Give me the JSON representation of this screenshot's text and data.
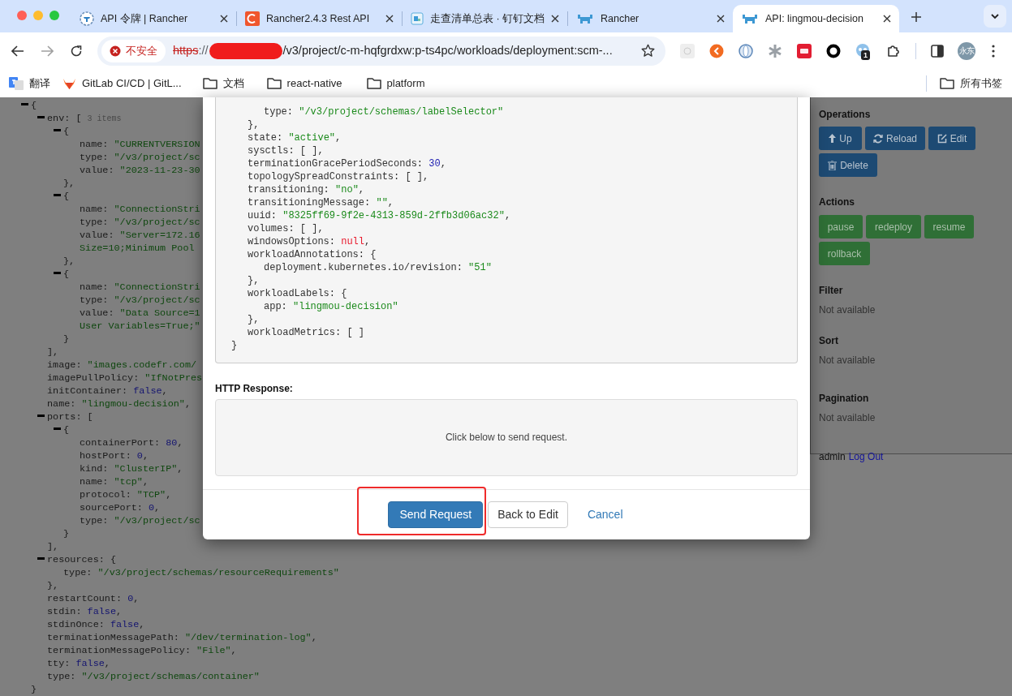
{
  "browser": {
    "tabs": [
      {
        "title": "API 令牌 | Rancher",
        "kind": "round",
        "selected": false
      },
      {
        "title": "Rancher2.4.3 Rest API",
        "kind": "orange",
        "selected": false
      },
      {
        "title": "走查清单总表 · 钉钉文档",
        "kind": "doc",
        "selected": false
      },
      {
        "title": "Rancher",
        "kind": "cattle",
        "selected": false
      },
      {
        "title": "API: lingmou-decision",
        "kind": "cattle",
        "selected": true
      }
    ],
    "security_label": "不安全",
    "url": {
      "scheme": "https",
      "separator": "://",
      "path": "/v3/project/c-m-hqfgrdxw:p-ts4pc/workloads/deployment:scm-..."
    },
    "extension_badge": "1",
    "avatar": "永东",
    "bookmarks": [
      {
        "kind": "translate",
        "label": "翻译"
      },
      {
        "kind": "gitlab",
        "label": "GitLab CI/CD | GitL..."
      },
      {
        "kind": "folder",
        "label": "文档"
      },
      {
        "kind": "folder",
        "label": "react-native"
      },
      {
        "kind": "folder",
        "label": "platform"
      }
    ],
    "all_bookmarks": "所有书签"
  },
  "page_code": {
    "expanded": true,
    "parts": [
      {
        "kind": "p",
        "text": "{"
      }
    ],
    "children": [
      {
        "expanded": true,
        "parts": [
          {
            "kind": "k",
            "text": "env: "
          },
          {
            "kind": "p",
            "text": "[ "
          },
          {
            "kind": "c",
            "text": "3 items"
          }
        ],
        "children": [
          {
            "expanded": true,
            "parts": [
              {
                "kind": "p",
                "text": "{"
              }
            ],
            "children": [
              {
                "parts": [
                  {
                    "kind": "k",
                    "text": "name: "
                  },
                  {
                    "kind": "s",
                    "text": "\"CURRENTVERSION"
                  }
                ]
              },
              {
                "parts": [
                  {
                    "kind": "k",
                    "text": "type: "
                  },
                  {
                    "kind": "s",
                    "text": "\"/v3/project/sc"
                  }
                ]
              },
              {
                "parts": [
                  {
                    "kind": "k",
                    "text": "value: "
                  },
                  {
                    "kind": "s",
                    "text": "\"2023-11-23-30"
                  }
                ]
              }
            ],
            "close": [
              {
                "kind": "p",
                "text": "},"
              }
            ]
          },
          {
            "expanded": true,
            "parts": [
              {
                "kind": "p",
                "text": "{"
              }
            ],
            "children": [
              {
                "parts": [
                  {
                    "kind": "k",
                    "text": "name: "
                  },
                  {
                    "kind": "s",
                    "text": "\"ConnectionStri"
                  }
                ]
              },
              {
                "parts": [
                  {
                    "kind": "k",
                    "text": "type: "
                  },
                  {
                    "kind": "s",
                    "text": "\"/v3/project/sc"
                  }
                ]
              },
              {
                "parts": [
                  {
                    "kind": "k",
                    "text": "value: "
                  },
                  {
                    "kind": "s",
                    "text": "\"Server=172.16"
                  }
                ]
              },
              {
                "parts": [
                  {
                    "kind": "s",
                    "text": "Size=10;Minimum Pool"
                  }
                ]
              }
            ],
            "close": [
              {
                "kind": "p",
                "text": "},"
              }
            ]
          },
          {
            "expanded": true,
            "parts": [
              {
                "kind": "p",
                "text": "{"
              }
            ],
            "children": [
              {
                "parts": [
                  {
                    "kind": "k",
                    "text": "name: "
                  },
                  {
                    "kind": "s",
                    "text": "\"ConnectionStri"
                  }
                ]
              },
              {
                "parts": [
                  {
                    "kind": "k",
                    "text": "type: "
                  },
                  {
                    "kind": "s",
                    "text": "\"/v3/project/sc"
                  }
                ]
              },
              {
                "parts": [
                  {
                    "kind": "k",
                    "text": "value: "
                  },
                  {
                    "kind": "s",
                    "text": "\"Data Source=1"
                  }
                ]
              },
              {
                "parts": [
                  {
                    "kind": "s",
                    "text": "User Variables=True;\""
                  }
                ]
              }
            ],
            "close": [
              {
                "kind": "p",
                "text": "}"
              }
            ]
          }
        ],
        "close": [
          {
            "kind": "p",
            "text": "],"
          }
        ]
      },
      {
        "parts": [
          {
            "kind": "k",
            "text": "image: "
          },
          {
            "kind": "s",
            "text": "\"images.codefr.com/"
          }
        ]
      },
      {
        "parts": [
          {
            "kind": "k",
            "text": "imagePullPolicy: "
          },
          {
            "kind": "s",
            "text": "\"IfNotPres"
          }
        ]
      },
      {
        "parts": [
          {
            "kind": "k",
            "text": "initContainer: "
          },
          {
            "kind": "n",
            "text": "false"
          },
          {
            "kind": "p",
            "text": ","
          }
        ]
      },
      {
        "parts": [
          {
            "kind": "k",
            "text": "name: "
          },
          {
            "kind": "s",
            "text": "\"lingmou-decision\""
          },
          {
            "kind": "p",
            "text": ","
          }
        ]
      },
      {
        "expanded": true,
        "parts": [
          {
            "kind": "k",
            "text": "ports: "
          },
          {
            "kind": "p",
            "text": "["
          }
        ],
        "children": [
          {
            "expanded": true,
            "parts": [
              {
                "kind": "p",
                "text": "{"
              }
            ],
            "children": [
              {
                "parts": [
                  {
                    "kind": "k",
                    "text": "containerPort: "
                  },
                  {
                    "kind": "n",
                    "text": "80"
                  },
                  {
                    "kind": "p",
                    "text": ","
                  }
                ]
              },
              {
                "parts": [
                  {
                    "kind": "k",
                    "text": "hostPort: "
                  },
                  {
                    "kind": "n",
                    "text": "0"
                  },
                  {
                    "kind": "p",
                    "text": ","
                  }
                ]
              },
              {
                "parts": [
                  {
                    "kind": "k",
                    "text": "kind: "
                  },
                  {
                    "kind": "s",
                    "text": "\"ClusterIP\""
                  },
                  {
                    "kind": "p",
                    "text": ","
                  }
                ]
              },
              {
                "parts": [
                  {
                    "kind": "k",
                    "text": "name: "
                  },
                  {
                    "kind": "s",
                    "text": "\"tcp\""
                  },
                  {
                    "kind": "p",
                    "text": ","
                  }
                ]
              },
              {
                "parts": [
                  {
                    "kind": "k",
                    "text": "protocol: "
                  },
                  {
                    "kind": "s",
                    "text": "\"TCP\""
                  },
                  {
                    "kind": "p",
                    "text": ","
                  }
                ]
              },
              {
                "parts": [
                  {
                    "kind": "k",
                    "text": "sourcePort: "
                  },
                  {
                    "kind": "n",
                    "text": "0"
                  },
                  {
                    "kind": "p",
                    "text": ","
                  }
                ]
              },
              {
                "parts": [
                  {
                    "kind": "k",
                    "text": "type: "
                  },
                  {
                    "kind": "s",
                    "text": "\"/v3/project/sc"
                  }
                ]
              }
            ],
            "close": [
              {
                "kind": "p",
                "text": "}"
              }
            ]
          }
        ],
        "close": [
          {
            "kind": "p",
            "text": "],"
          }
        ]
      },
      {
        "expanded": true,
        "parts": [
          {
            "kind": "k",
            "text": "resources: "
          },
          {
            "kind": "p",
            "text": "{"
          }
        ],
        "children": [
          {
            "parts": [
              {
                "kind": "k",
                "text": "type: "
              },
              {
                "kind": "s",
                "text": "\"/v3/project/schemas/resourceRequirements\""
              }
            ]
          }
        ],
        "close": [
          {
            "kind": "p",
            "text": "},"
          }
        ]
      },
      {
        "parts": [
          {
            "kind": "k",
            "text": "restartCount: "
          },
          {
            "kind": "n",
            "text": "0"
          },
          {
            "kind": "p",
            "text": ","
          }
        ]
      },
      {
        "parts": [
          {
            "kind": "k",
            "text": "stdin: "
          },
          {
            "kind": "n",
            "text": "false"
          },
          {
            "kind": "p",
            "text": ","
          }
        ]
      },
      {
        "parts": [
          {
            "kind": "k",
            "text": "stdinOnce: "
          },
          {
            "kind": "n",
            "text": "false"
          },
          {
            "kind": "p",
            "text": ","
          }
        ]
      },
      {
        "parts": [
          {
            "kind": "k",
            "text": "terminationMessagePath: "
          },
          {
            "kind": "s",
            "text": "\"/dev/termination-log\""
          },
          {
            "kind": "p",
            "text": ","
          }
        ]
      },
      {
        "parts": [
          {
            "kind": "k",
            "text": "terminationMessagePolicy: "
          },
          {
            "kind": "s",
            "text": "\"File\""
          },
          {
            "kind": "p",
            "text": ","
          }
        ]
      },
      {
        "parts": [
          {
            "kind": "k",
            "text": "tty: "
          },
          {
            "kind": "n",
            "text": "false"
          },
          {
            "kind": "p",
            "text": ","
          }
        ]
      },
      {
        "parts": [
          {
            "kind": "k",
            "text": "type: "
          },
          {
            "kind": "s",
            "text": "\"/v3/project/schemas/container\""
          }
        ]
      }
    ],
    "close": [
      {
        "kind": "p",
        "text": "}"
      }
    ]
  },
  "side_panel": {
    "operations_title": "Operations",
    "operations": [
      {
        "kind": "up",
        "label": "Up"
      },
      {
        "kind": "reload",
        "label": "Reload"
      },
      {
        "kind": "edit",
        "label": "Edit"
      },
      {
        "kind": "delete",
        "label": "Delete"
      }
    ],
    "actions_title": "Actions",
    "actions": [
      "pause",
      "redeploy",
      "resume",
      "rollback"
    ],
    "sections": [
      {
        "title": "Filter",
        "text": "Not available"
      },
      {
        "title": "Sort",
        "text": "Not available"
      },
      {
        "title": "Pagination",
        "text": "Not available"
      }
    ],
    "user": "admin",
    "logout": "Log Out"
  },
  "modal": {
    "request_code": {
      "children": [
        {
          "children": [
            {
              "parts": [
                {
                  "kind": "k",
                  "text": "type: "
                },
                {
                  "kind": "s",
                  "text": "\"/v3/project/schemas/labelSelector\""
                }
              ]
            }
          ],
          "close": [
            {
              "kind": "p",
              "text": "},"
            }
          ]
        },
        {
          "parts": [
            {
              "kind": "k",
              "text": "state: "
            },
            {
              "kind": "s",
              "text": "\"active\""
            },
            {
              "kind": "p",
              "text": ","
            }
          ]
        },
        {
          "parts": [
            {
              "kind": "k",
              "text": "sysctls: "
            },
            {
              "kind": "p",
              "text": "[ ],"
            }
          ]
        },
        {
          "parts": [
            {
              "kind": "k",
              "text": "terminationGracePeriodSeconds: "
            },
            {
              "kind": "n",
              "text": "30"
            },
            {
              "kind": "p",
              "text": ","
            }
          ]
        },
        {
          "parts": [
            {
              "kind": "k",
              "text": "topologySpreadConstraints: "
            },
            {
              "kind": "p",
              "text": "[ ],"
            }
          ]
        },
        {
          "parts": [
            {
              "kind": "k",
              "text": "transitioning: "
            },
            {
              "kind": "s",
              "text": "\"no\""
            },
            {
              "kind": "p",
              "text": ","
            }
          ]
        },
        {
          "parts": [
            {
              "kind": "k",
              "text": "transitioningMessage: "
            },
            {
              "kind": "s",
              "text": "\"\""
            },
            {
              "kind": "p",
              "text": ","
            }
          ]
        },
        {
          "parts": [
            {
              "kind": "k",
              "text": "uuid: "
            },
            {
              "kind": "s",
              "text": "\"8325ff69-9f2e-4313-859d-2ffb3d06ac32\""
            },
            {
              "kind": "p",
              "text": ","
            }
          ]
        },
        {
          "parts": [
            {
              "kind": "k",
              "text": "volumes: "
            },
            {
              "kind": "p",
              "text": "[ ],"
            }
          ]
        },
        {
          "parts": [
            {
              "kind": "k",
              "text": "windowsOptions: "
            },
            {
              "kind": "x",
              "text": "null"
            },
            {
              "kind": "p",
              "text": ","
            }
          ]
        },
        {
          "parts": [
            {
              "kind": "k",
              "text": "workloadAnnotations: "
            },
            {
              "kind": "p",
              "text": "{"
            }
          ],
          "children": [
            {
              "parts": [
                {
                  "kind": "k",
                  "text": "deployment.kubernetes.io/revision: "
                },
                {
                  "kind": "s",
                  "text": "\"51\""
                }
              ]
            }
          ],
          "close": [
            {
              "kind": "p",
              "text": "},"
            }
          ]
        },
        {
          "parts": [
            {
              "kind": "k",
              "text": "workloadLabels: "
            },
            {
              "kind": "p",
              "text": "{"
            }
          ],
          "children": [
            {
              "parts": [
                {
                  "kind": "k",
                  "text": "app: "
                },
                {
                  "kind": "s",
                  "text": "\"lingmou-decision\""
                }
              ]
            }
          ],
          "close": [
            {
              "kind": "p",
              "text": "},"
            }
          ]
        },
        {
          "parts": [
            {
              "kind": "k",
              "text": "workloadMetrics: "
            },
            {
              "kind": "p",
              "text": "[ ]"
            }
          ]
        }
      ],
      "close": [
        {
          "kind": "p",
          "text": "}"
        }
      ]
    },
    "response_label": "HTTP Response:",
    "response_message": "Click below to send request.",
    "buttons": [
      {
        "kind": "primary",
        "label": "Send Request",
        "highlighted": true
      },
      {
        "kind": "default",
        "label": "Back to Edit",
        "highlighted": false
      },
      {
        "kind": "link",
        "label": "Cancel",
        "highlighted": false
      }
    ]
  }
}
